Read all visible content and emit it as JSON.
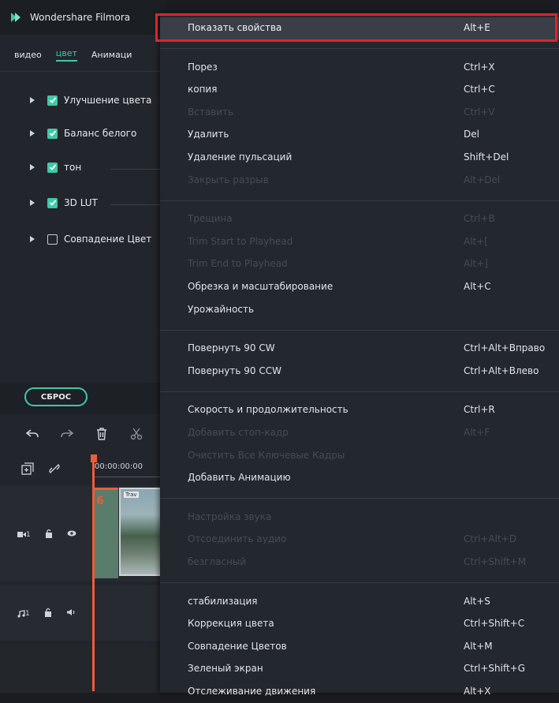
{
  "app": {
    "title": "Wondershare Filmora",
    "tabs": [
      "видео",
      "цвет",
      "Анимаци"
    ],
    "active_tab": "цвет",
    "color_props": [
      {
        "label": "Улучшение цвета",
        "checked": true
      },
      {
        "label": "Баланс белого",
        "checked": true
      },
      {
        "label": "тон",
        "checked": true
      },
      {
        "label": "3D LUT",
        "checked": true
      },
      {
        "label": "Совпадение Цвет",
        "checked": false
      }
    ],
    "reset_label": "СБРОС",
    "timecode": "00:00:00:00",
    "video_track_num": "1",
    "audio_track_num": "1",
    "clip_marker": "6",
    "clip_label": "Trav"
  },
  "menu": {
    "groups": [
      [
        {
          "label": "Показать свойства",
          "shortcut": "Alt+E",
          "enabled": true,
          "highlighted": true
        }
      ],
      [
        {
          "label": "Порез",
          "shortcut": "Ctrl+X",
          "enabled": true
        },
        {
          "label": "копия",
          "shortcut": "Ctrl+C",
          "enabled": true
        },
        {
          "label": "Вставить",
          "shortcut": "Ctrl+V",
          "enabled": false
        },
        {
          "label": "Удалить",
          "shortcut": "Del",
          "enabled": true
        },
        {
          "label": "Удаление пульсаций",
          "shortcut": "Shift+Del",
          "enabled": true
        },
        {
          "label": "Закрыть разрыв",
          "shortcut": "Alt+Del",
          "enabled": false
        }
      ],
      [
        {
          "label": "Трещина",
          "shortcut": "Ctrl+B",
          "enabled": false
        },
        {
          "label": "Trim Start to Playhead",
          "shortcut": "Alt+[",
          "enabled": false
        },
        {
          "label": "Trim End to Playhead",
          "shortcut": "Alt+]",
          "enabled": false
        },
        {
          "label": "Обрезка и масштабирование",
          "shortcut": "Alt+C",
          "enabled": true
        },
        {
          "label": "Урожайность",
          "shortcut": "",
          "enabled": true
        }
      ],
      [
        {
          "label": "Повернуть 90 CW",
          "shortcut": "Ctrl+Alt+Вправо",
          "enabled": true
        },
        {
          "label": "Повернуть 90 CCW",
          "shortcut": "Ctrl+Alt+Влево",
          "enabled": true
        }
      ],
      [
        {
          "label": "Скорость и продолжительность",
          "shortcut": "Ctrl+R",
          "enabled": true
        },
        {
          "label": "Добавить стоп-кадр",
          "shortcut": "Alt+F",
          "enabled": false
        },
        {
          "label": "Очистить Все Ключевые Кадры",
          "shortcut": "",
          "enabled": false
        },
        {
          "label": "Добавить Анимацию",
          "shortcut": "",
          "enabled": true
        }
      ],
      [
        {
          "label": "Настройка звука",
          "shortcut": "",
          "enabled": false
        },
        {
          "label": "Отсоединить аудио",
          "shortcut": "Ctrl+Alt+D",
          "enabled": false
        },
        {
          "label": "безгласный",
          "shortcut": "Ctrl+Shift+M",
          "enabled": false
        }
      ],
      [
        {
          "label": "стабилизация",
          "shortcut": "Alt+S",
          "enabled": true
        },
        {
          "label": "Коррекция цвета",
          "shortcut": "Ctrl+Shift+C",
          "enabled": true
        },
        {
          "label": "Совпадение Цветов",
          "shortcut": "Alt+M",
          "enabled": true
        },
        {
          "label": "Зеленый экран",
          "shortcut": "Ctrl+Shift+G",
          "enabled": true
        },
        {
          "label": "Отслеживание движения",
          "shortcut": "Alt+X",
          "enabled": true
        }
      ]
    ]
  },
  "colors": {
    "accent": "#40c8a8",
    "highlight_border": "#d8262e",
    "playhead": "#ee5c3c"
  }
}
